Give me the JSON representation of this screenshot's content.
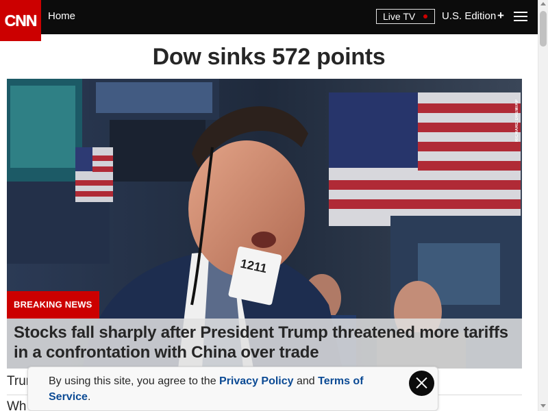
{
  "header": {
    "logo_text": "CNN",
    "home_label": "Home",
    "live_tv_label": "Live TV",
    "edition_label": "U.S. Edition",
    "plus_glyph": "+"
  },
  "headline": "Dow sinks 572 points",
  "hero": {
    "photo_credit": "RICHARD DREW/AP",
    "badge_number": "1211",
    "breaking_label": "BREAKING NEWS",
    "caption": "Stocks fall sharply after President Trump threatened more tariffs in a confrontation with China over trade"
  },
  "stories": [
    {
      "text": "Trump"
    },
    {
      "text": "Wh"
    }
  ],
  "cookie_banner": {
    "text_before": "By using this site, you agree to the ",
    "privacy_label": "Privacy Policy",
    "text_middle": " and ",
    "terms_label": "Terms of Service",
    "text_after": "."
  },
  "colors": {
    "brand_red": "#cc0000",
    "header_bg": "#0c0c0c",
    "link_blue": "#0b4a94"
  },
  "icons": [
    "hamburger-menu-icon",
    "close-icon",
    "live-dot-icon"
  ]
}
